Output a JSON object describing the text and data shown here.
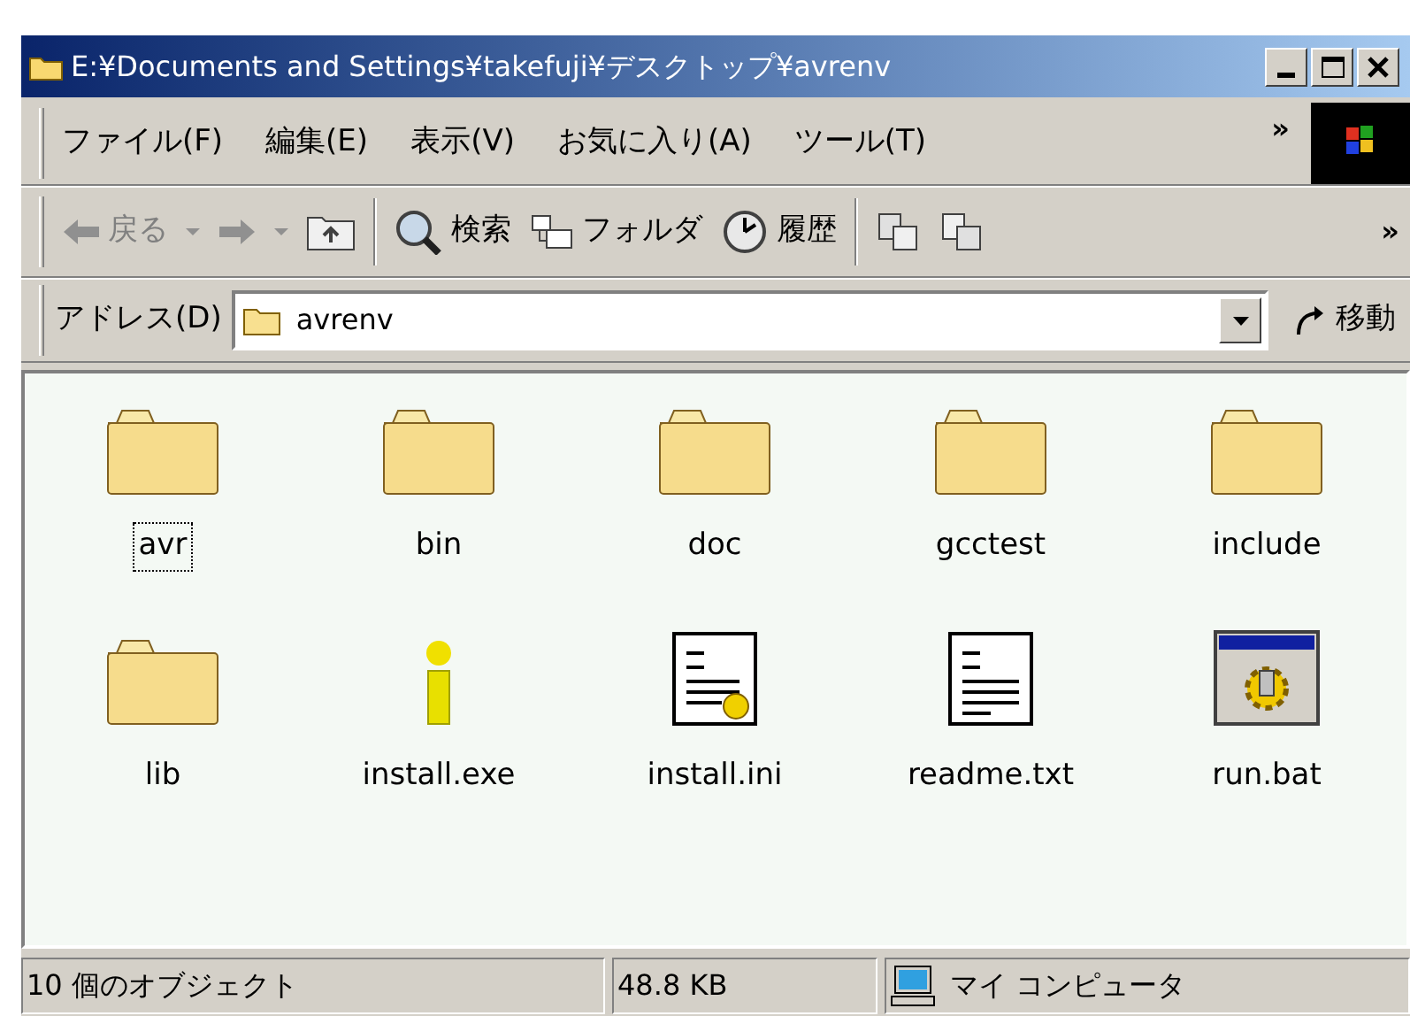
{
  "window": {
    "title": "E:¥Documents and Settings¥takefuji¥デスクトップ¥avrenv"
  },
  "menu": [
    {
      "label": "ファイル(F)"
    },
    {
      "label": "編集(E)"
    },
    {
      "label": "表示(V)"
    },
    {
      "label": "お気に入り(A)"
    },
    {
      "label": "ツール(T)"
    }
  ],
  "menu_more": "»",
  "toolbar": [
    {
      "kind": "back",
      "label": "戻る",
      "disabled": true
    },
    {
      "kind": "forward",
      "disabled": true
    },
    {
      "kind": "up",
      "disabled": false
    },
    {
      "kind": "search",
      "label": "検索",
      "disabled": false
    },
    {
      "kind": "folders",
      "label": "フォルダ",
      "disabled": false
    },
    {
      "kind": "history",
      "label": "履歴",
      "disabled": false
    },
    {
      "kind": "move",
      "disabled": false
    },
    {
      "kind": "copy",
      "disabled": false
    }
  ],
  "toolbar_more": "»",
  "address": {
    "label": "アドレス(D)",
    "value": "avrenv",
    "go": "移動"
  },
  "files": [
    {
      "name": "avr",
      "kind": "folder",
      "focused": true
    },
    {
      "name": "bin",
      "kind": "folder",
      "focused": false
    },
    {
      "name": "doc",
      "kind": "folder",
      "focused": false
    },
    {
      "name": "gcctest",
      "kind": "folder",
      "focused": false
    },
    {
      "name": "include",
      "kind": "folder",
      "focused": false
    },
    {
      "name": "lib",
      "kind": "folder",
      "focused": false
    },
    {
      "name": "install.exe",
      "kind": "exe",
      "focused": false
    },
    {
      "name": "install.ini",
      "kind": "ini",
      "focused": false
    },
    {
      "name": "readme.txt",
      "kind": "txt",
      "focused": false
    },
    {
      "name": "run.bat",
      "kind": "bat",
      "focused": false
    }
  ],
  "status_bar": {
    "objects": "10 個のオブジェクト",
    "size": "48.8 KB",
    "zone": "マイ コンピュータ"
  }
}
